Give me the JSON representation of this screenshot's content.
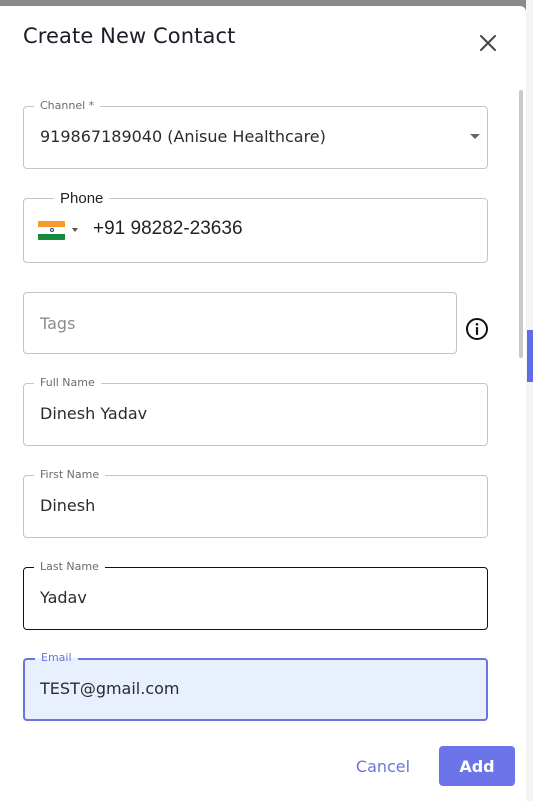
{
  "dialog": {
    "title": "Create New Contact",
    "close_icon": "close-icon"
  },
  "fields": {
    "channel": {
      "label": "Channel *",
      "value": "919867189040 (Anisue Healthcare)"
    },
    "phone": {
      "label": "Phone",
      "country_flag": "india-flag",
      "value": "+91 98282-23636"
    },
    "tags": {
      "placeholder": "Tags",
      "info_icon": "info-icon"
    },
    "full_name": {
      "label": "Full Name",
      "value": "Dinesh Yadav"
    },
    "first_name": {
      "label": "First Name",
      "value": "Dinesh"
    },
    "last_name": {
      "label": "Last Name",
      "value": "Yadav"
    },
    "email": {
      "label": "Email",
      "value": "TEST@gmail.com"
    }
  },
  "actions": {
    "cancel_label": "Cancel",
    "add_label": "Add"
  },
  "colors": {
    "accent": "#6b74e8",
    "focused_bg": "#e8effd"
  }
}
